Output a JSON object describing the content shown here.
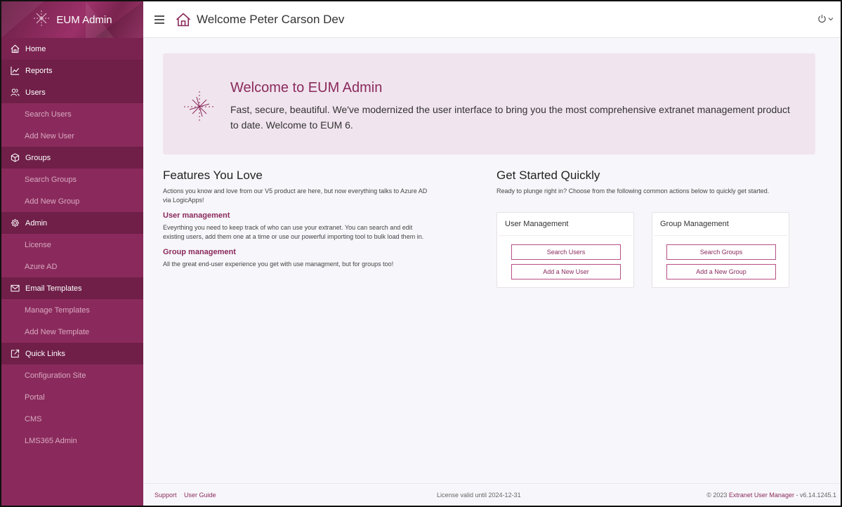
{
  "brand": {
    "title": "EUM Admin"
  },
  "topbar": {
    "title": "Welcome Peter Carson Dev"
  },
  "sidebar": {
    "home": "Home",
    "reports": "Reports",
    "users": {
      "label": "Users",
      "items": [
        "Search Users",
        "Add New User"
      ]
    },
    "groups": {
      "label": "Groups",
      "items": [
        "Search Groups",
        "Add New Group"
      ]
    },
    "admin": {
      "label": "Admin",
      "items": [
        "License",
        "Azure AD"
      ]
    },
    "email": {
      "label": "Email Templates",
      "items": [
        "Manage Templates",
        "Add New Template"
      ]
    },
    "quicklinks": {
      "label": "Quick Links",
      "items": [
        "Configuration Site",
        "Portal",
        "CMS",
        "LMS365 Admin"
      ]
    }
  },
  "hero": {
    "title": "Welcome to EUM Admin",
    "text": "Fast, secure, beautiful. We've modernized the user interface to bring you the most comprehensive extranet management product to date. Welcome to EUM 6."
  },
  "features": {
    "title": "Features You Love",
    "intro": "Actions you know and love from our V5 product are here, but now everything talks to Azure AD via LogicApps!",
    "user_title": "User management",
    "user_text": "Eveyrthing you need to keep track of who can use your extranet. You can search and edit existing users, add them one at a time or use our powerful importing tool to bulk load them in.",
    "group_title": "Group management",
    "group_text": "All the great end-user experience you get with use managment, but for groups too!"
  },
  "getstarted": {
    "title": "Get Started Quickly",
    "intro": "Ready to plunge right in? Choose from the following common actions below to quickly get started.",
    "user_card": {
      "title": "User Management",
      "btn1": "Search Users",
      "btn2": "Add a New User"
    },
    "group_card": {
      "title": "Group Management",
      "btn1": "Search Groups",
      "btn2": "Add a New Group"
    }
  },
  "footer": {
    "support": "Support",
    "guide": "User Guide",
    "license": "License valid until 2024-12-31",
    "copy_prefix": "© 2023",
    "company": "Extranet User Manager",
    "version": " - v6.14.1245.1"
  },
  "colors": {
    "accent": "#8a2a5c",
    "sidebar": "#8a2a5c",
    "section": "#6f1f48",
    "hero_bg": "#f0e4ee"
  },
  "icons": {
    "brand": "sparkle-icon",
    "home": "home-icon",
    "reports": "chart-line-icon",
    "users": "users-icon",
    "groups": "cube-icon",
    "admin": "gear-icon",
    "email": "envelope-icon",
    "quicklinks": "external-link-icon",
    "menu": "hamburger-icon",
    "power": "power-icon"
  }
}
